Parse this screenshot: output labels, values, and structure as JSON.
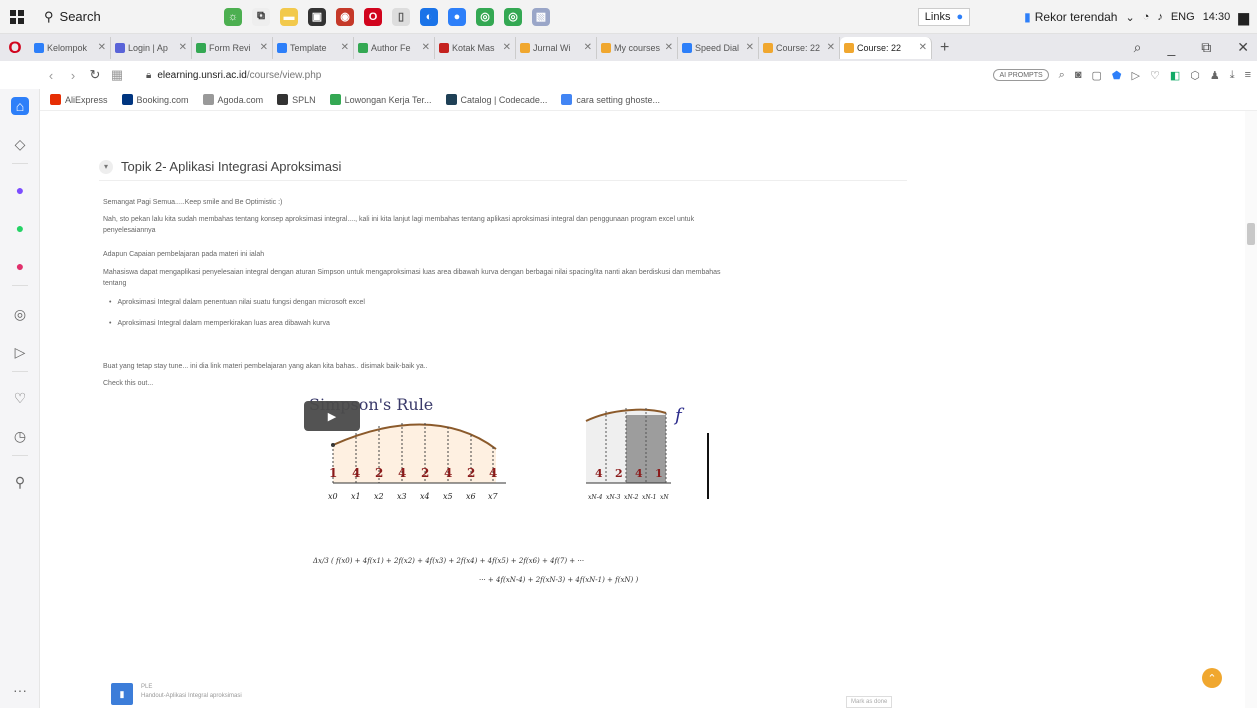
{
  "taskbar": {
    "search_label": "Search",
    "links_label": "Links",
    "weather_text": "Rekor terendah",
    "lang": "ENG",
    "time": "14:30"
  },
  "tabs": [
    {
      "label": "Kelompok",
      "color": "#2d7ff9"
    },
    {
      "label": "Login | Ap",
      "color": "#5a64d8"
    },
    {
      "label": "Form Revi",
      "color": "#34a853"
    },
    {
      "label": "Template",
      "color": "#2d7ff9"
    },
    {
      "label": "Author Fe",
      "color": "#34a853"
    },
    {
      "label": "Kotak Mas",
      "color": "#c5221f"
    },
    {
      "label": "Jurnal Wi",
      "color": "#f0a72f"
    },
    {
      "label": "My courses",
      "color": "#f0a72f"
    },
    {
      "label": "Speed Dial",
      "color": "#2d7ff9"
    },
    {
      "label": "Course: 22",
      "color": "#f0a72f"
    },
    {
      "label": "Course: 22",
      "color": "#f0a72f",
      "active": true
    }
  ],
  "address": {
    "url_domain": "elearning.unsri.ac.id",
    "url_path": "/course/view.php",
    "ai_badge": "AI PROMPTS"
  },
  "bookmarks": [
    {
      "label": "AliExpress",
      "color": "#e62e04"
    },
    {
      "label": "Booking.com",
      "color": "#003580"
    },
    {
      "label": "Agoda.com",
      "color": "#999999"
    },
    {
      "label": "SPLN",
      "color": "#333333"
    },
    {
      "label": "Lowongan Kerja Ter...",
      "color": "#34a853"
    },
    {
      "label": "Catalog | Codecade...",
      "color": "#1f4056"
    },
    {
      "label": "cara setting ghoste...",
      "color": "#4285f4"
    }
  ],
  "content": {
    "section_title": "Topik 2- Aplikasi Integrasi Aproksimasi",
    "p1": "Semangat Pagi Semua.....Keep smile and Be Optimistic :)",
    "p2": "Nah, sto pekan lalu kita sudah membahas tentang konsep  aproksimasi integral...., kali ini kita lanjut lagi membahas tentang aplikasi aproksimasi integral dan penggunaan program excel untuk",
    "p2b": "penyelesaiannya",
    "p3": "Adapun  Capaian pembelajaran pada materi ini ialah",
    "p4": "Mahasiswa dapat mengaplikasi penyelesaian integral dengan aturan Simpson untuk mengaproksimasi luas area dibawah kurva dengan berbagai nilai spacing/ita nanti akan berdiskusi dan membahas",
    "p4b": "tentang",
    "bullet1": "Aproksimasi Integral dalam penentuan nilai suatu fungsi dengan microsoft excel",
    "bullet2": "Aproksimasi Integral dalam memperkirakan luas area dibawah kurva",
    "p5": "Buat yang tetap stay tune... ini dia link materi pembelajaran yang akan kita bahas.. disimak baik-baik ya..",
    "p6": "Check this out...",
    "video_title": "Simpson's Rule",
    "weights": [
      "1",
      "4",
      "2",
      "4",
      "2",
      "4",
      "2",
      "4"
    ],
    "x_labels": [
      "x0",
      "x1",
      "x2",
      "x3",
      "x4",
      "x5",
      "x6",
      "x7"
    ],
    "right_weights": [
      "4",
      "2",
      "4",
      "1"
    ],
    "right_x_labels": [
      "xN-4",
      "xN-3",
      "xN-2",
      "xN-1",
      "xN"
    ],
    "func_label": "f",
    "formula_line1": "Δx/3 ( f(x0) + 4f(x1) + 2f(x2) + 4f(x3) + 2f(x4) + 4f(x5) + 2f(x6) + 4f(7) + ···",
    "formula_line2": "··· + 4f(xN-4) + 2f(xN-3) + 4f(xN-1) + f(xN) )",
    "file_name": "PLE",
    "file_desc": "Handout-Aplikasi Integral aproksimasi",
    "mark_done": "Mark as done"
  }
}
